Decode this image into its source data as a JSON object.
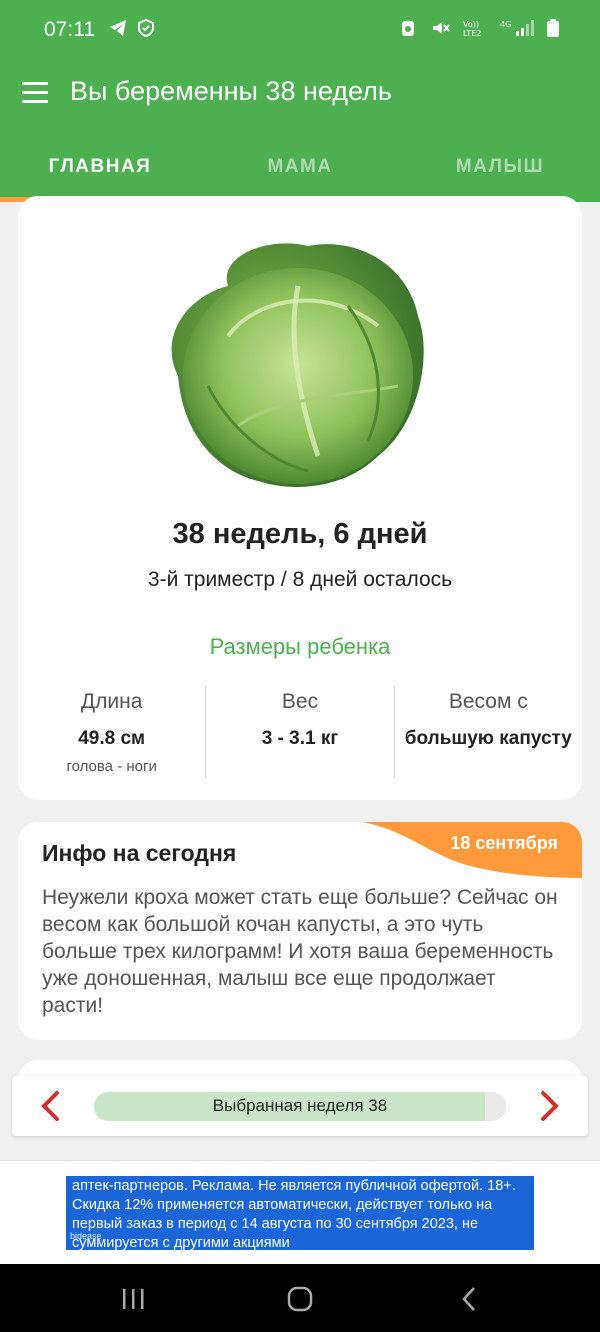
{
  "status_bar": {
    "time": "07:11",
    "left_icons": [
      "telegram-icon",
      "shield-check-icon"
    ],
    "right_icons": [
      "alarm-icon",
      "mute-icon",
      "volte-icon",
      "4g-signal-icon",
      "battery-icon"
    ]
  },
  "app_bar": {
    "title": "Вы беременны 38 недель",
    "menu_icon": "hamburger-menu-icon"
  },
  "tabs": [
    {
      "label": "ГЛАВНАЯ",
      "active": true
    },
    {
      "label": "МАМА",
      "active": false
    },
    {
      "label": "МАЛЫШ",
      "active": false
    }
  ],
  "summary": {
    "image": "cabbage",
    "weeks_label": "38 недель, 6 дней",
    "trimester_label": "3-й триместр / 8 дней осталось",
    "sizes_title": "Размеры ребенка",
    "stats": [
      {
        "label": "Длина",
        "value": "49.8 см",
        "sub": "голова - ноги"
      },
      {
        "label": "Вес",
        "value": "3 - 3.1 кг",
        "sub": ""
      },
      {
        "label": "Весом с",
        "value": "большую капусту",
        "sub": ""
      }
    ]
  },
  "info": {
    "title": "Инфо на сегодня",
    "date": "18 сентября",
    "body": "Неужели кроха может стать еще больше? Сейчас он весом как большой кочан капусты, а это чуть больше трех килограмм! И хотя ваша беременность уже доношенная, малыш все еще продолжает расти!"
  },
  "week_nav": {
    "label": "Выбранная неделя 38",
    "progress": 0.95,
    "prev_icon": "chevron-left-icon",
    "next_icon": "chevron-right-icon"
  },
  "ad": {
    "text": "аптек-партнеров. Реклама. Не является публичной офертой. 18+. Скидка 12% применяется автоматически, действует только на первый заказ в период с 14 августа по 30 сентября 2023, не суммируется с другими акциями",
    "brand": "bidease"
  },
  "colors": {
    "primary": "#4caf50",
    "accent": "#ff9a3c",
    "progress_fill": "#c9e6c9",
    "arrow": "#d32f2f",
    "ad_bg": "#1a66d8"
  }
}
